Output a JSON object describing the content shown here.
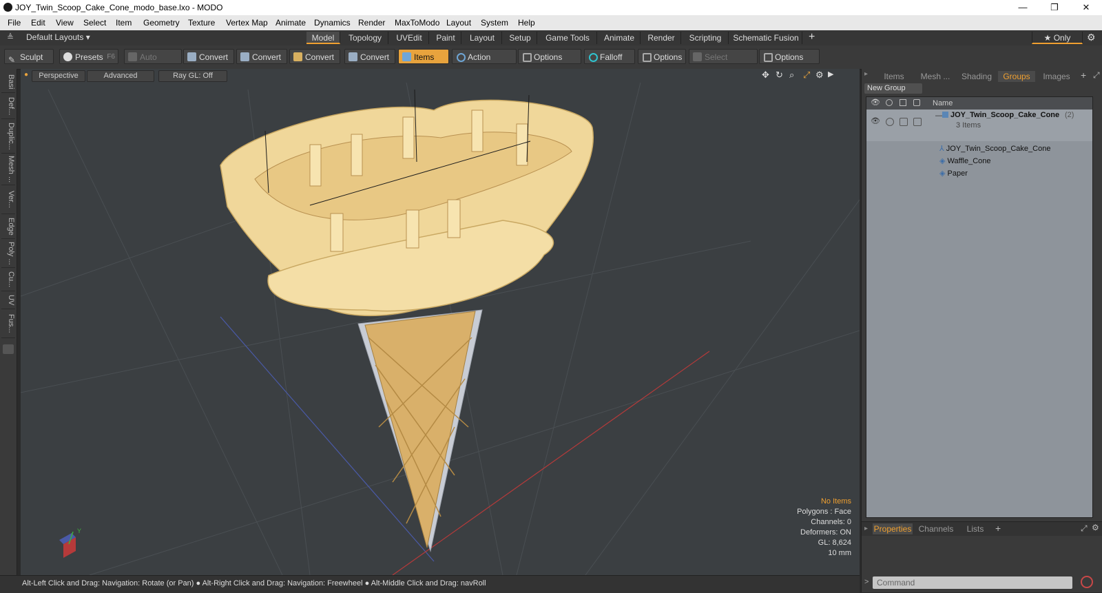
{
  "window": {
    "title": "JOY_Twin_Scoop_Cake_Cone_modo_base.lxo - MODO",
    "min_glyph": "—",
    "max_glyph": "❐",
    "close_glyph": "✕"
  },
  "menu": [
    "File",
    "Edit",
    "View",
    "Select",
    "Item",
    "Geometry",
    "Texture",
    "Vertex Map",
    "Animate",
    "Dynamics",
    "Render",
    "MaxToModo",
    "Layout",
    "System",
    "Help"
  ],
  "layout_bar": {
    "layouts_label": "Default Layouts ▾",
    "tabs": [
      "Model",
      "Topology",
      "UVEdit",
      "Paint",
      "Layout",
      "Setup",
      "Game Tools",
      "Animate",
      "Render",
      "Scripting",
      "Schematic Fusion"
    ],
    "active_tab": "Model",
    "add": "+",
    "only_label": "★ Only"
  },
  "toolbar": {
    "sculpt": "Sculpt",
    "presets": "Presets",
    "presets_key": "F6",
    "auto_select": "Auto Select",
    "convert": "Convert",
    "items": "Items",
    "action_center": "Action Center",
    "options": "Options",
    "falloff": "Falloff",
    "select_through": "Select Through"
  },
  "left_tabs": [
    "Basi",
    "Def...",
    "Duplic...",
    "Mesh ...",
    "Ver...",
    "Edge",
    "Poly ...",
    "Cu...",
    "UV",
    "Fus..."
  ],
  "viewport": {
    "perspective": "Perspective",
    "advanced": "Advanced",
    "raygl": "Ray GL: Off",
    "hud": {
      "no_items": "No Items",
      "polygons": "Polygons : Face",
      "channels": "Channels: 0",
      "deformers": "Deformers: ON",
      "gl": "GL: 8,624",
      "scale": "10 mm"
    },
    "axis_y": "Y"
  },
  "status": "Alt-Left Click and Drag: Navigation: Rotate (or Pan) ● Alt-Right Click and Drag: Navigation: Freewheel ● Alt-Middle Click and Drag: navRoll",
  "right_panel": {
    "tabs": [
      "Items",
      "Mesh ...",
      "Shading",
      "Groups",
      "Images"
    ],
    "active_tab": "Groups",
    "add": "+",
    "new_group": "New Group",
    "name_col": "Name",
    "group_name": "JOY_Twin_Scoop_Cake_Cone",
    "group_count": "(2)",
    "group_items": "3 Items",
    "children": [
      "JOY_Twin_Scoop_Cake_Cone",
      "Waffle_Cone",
      "Paper"
    ],
    "bottom_tabs": [
      "Properties",
      "Channels",
      "Lists"
    ],
    "bottom_active": "Properties",
    "command_placeholder": "Command"
  },
  "colors": {
    "accent": "#f0a030",
    "viewport_bg": "#3b3f42",
    "cone": "#e8c884"
  }
}
